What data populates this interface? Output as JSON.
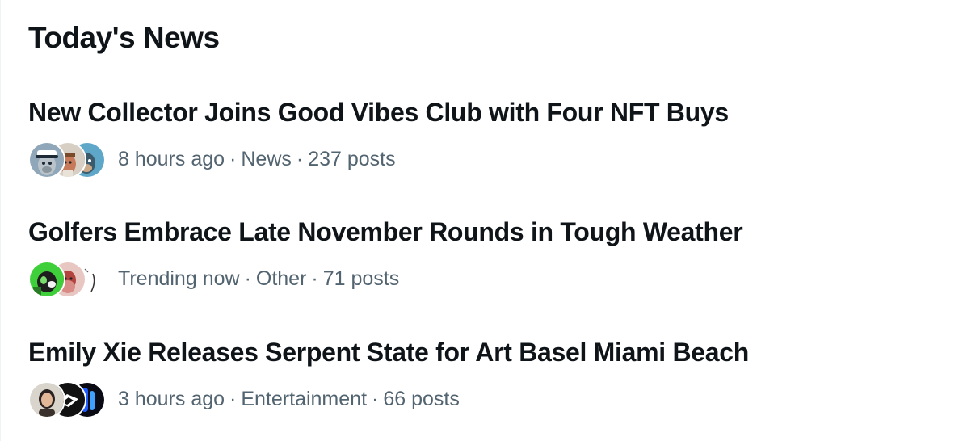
{
  "section": {
    "title": "Today's News"
  },
  "news": [
    {
      "headline": "New Collector Joins Good Vibes Club with Four NFT Buys",
      "time": "8 hours ago",
      "category": "News",
      "posts": "237 posts",
      "avatars": [
        "captain-ape-avatar",
        "character-avatar",
        "blue-ape-avatar"
      ]
    },
    {
      "headline": "Golfers Embrace Late November Rounds in Tough Weather",
      "time": "Trending now",
      "category": "Other",
      "posts": "71 posts",
      "avatars": [
        "green-character-avatar",
        "red-character-avatar",
        "sketch-avatar"
      ]
    },
    {
      "headline": "Emily Xie Releases Serpent State for Art Basel Miami Beach",
      "time": "3 hours ago",
      "category": "Entertainment",
      "posts": "66 posts",
      "avatars": [
        "woman-portrait-avatar",
        "dark-logo-avatar",
        "blue-abstract-avatar"
      ]
    }
  ],
  "separator": "·"
}
